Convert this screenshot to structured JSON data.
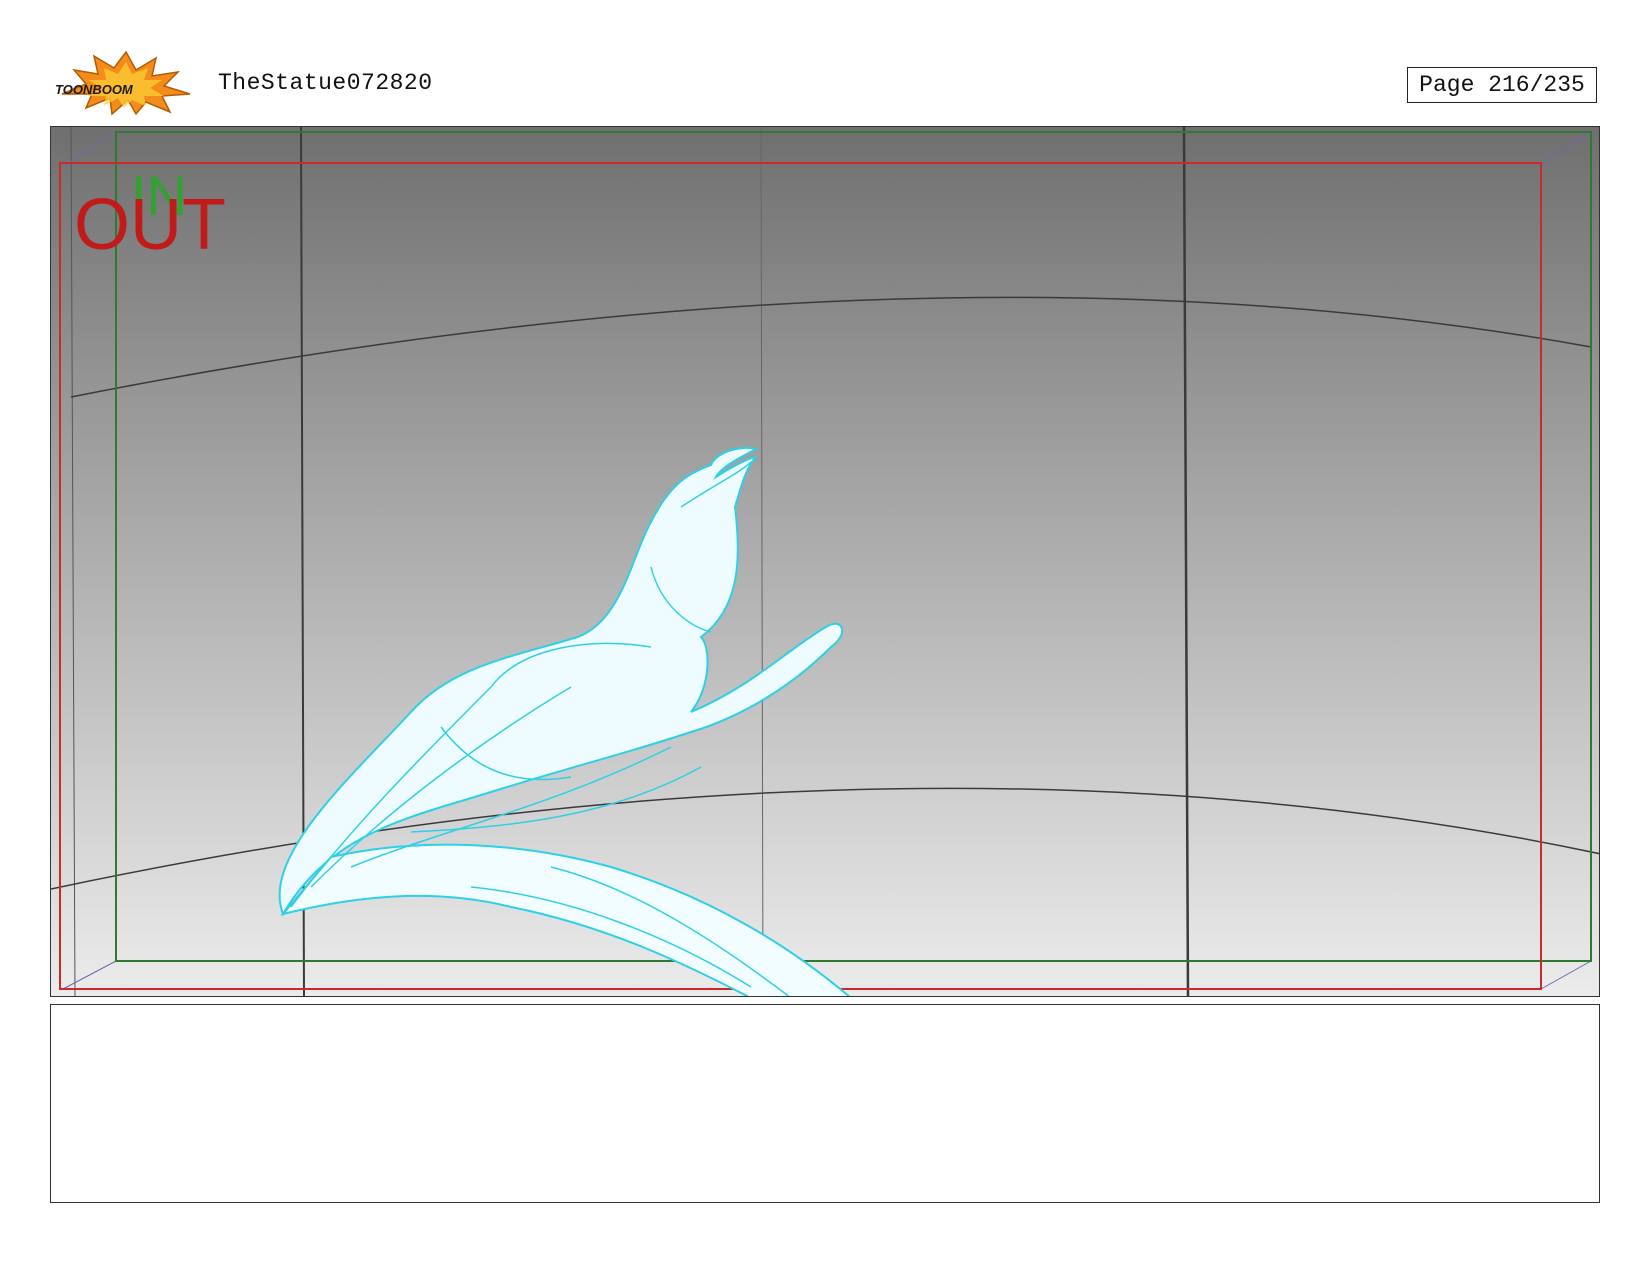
{
  "header": {
    "logo_text": "TOONBOOM",
    "title": "TheStatue072820",
    "page_label": "Page 216/235"
  },
  "panel": {
    "in_label": "IN",
    "out_label": "OUT"
  },
  "caption": {
    "text": ""
  },
  "colors": {
    "in_frame": "#2f7a2f",
    "out_frame": "#cc2a2a",
    "sketch_line": "#2fd0e6",
    "sketch_fill": "#eefcff",
    "logo_burst": "#f28c1a"
  }
}
